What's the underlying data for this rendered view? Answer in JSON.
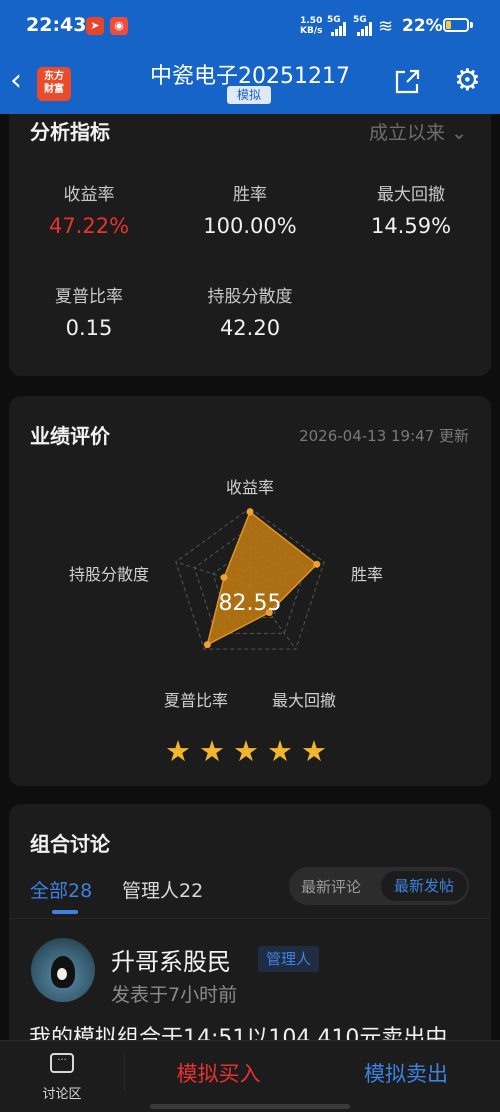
{
  "status_bar": {
    "time": "22:43",
    "net_speed_value": "1.50",
    "net_speed_unit": "KB/s",
    "sig1": "5G",
    "sig2": "5G",
    "battery": "22%"
  },
  "nav": {
    "logo_line1": "东方",
    "logo_line2": "财富",
    "title": "中瓷电子20251217",
    "badge": "模拟"
  },
  "analysis": {
    "title": "分析指标",
    "range": "成立以来",
    "metrics": [
      {
        "label": "收益率",
        "value": "47.22%"
      },
      {
        "label": "胜率",
        "value": "100.00%"
      },
      {
        "label": "最大回撤",
        "value": "14.59%"
      },
      {
        "label": "夏普比率",
        "value": "0.15"
      },
      {
        "label": "持股分散度",
        "value": "42.20"
      }
    ]
  },
  "performance": {
    "title": "业绩评价",
    "updated": "2026-04-13 19:47 更新",
    "score": "82.55",
    "radar_labels": [
      "收益率",
      "胜率",
      "最大回撤",
      "夏普比率",
      "持股分散度"
    ],
    "radar_values": [
      0.95,
      0.9,
      0.42,
      0.93,
      0.35
    ],
    "rating_stars": 5,
    "accent_color": "#c47d12",
    "star_color": "#f2b530"
  },
  "discussion": {
    "title": "组合讨论",
    "tab_all": "全部28",
    "tab_manager": "管理人22",
    "sort_latest_comment": "最新评论",
    "sort_latest_post": "最新发帖",
    "post": {
      "author": "升哥系股民",
      "role": "管理人",
      "posted": "发表于7小时前",
      "text": "我的模拟组合于14:51以104.410元卖出中"
    }
  },
  "bottom_bar": {
    "discuss_label": "讨论区",
    "buy_label": "模拟买入",
    "sell_label": "模拟卖出"
  },
  "colors": {
    "brand_blue": "#1664c8",
    "red": "#e8322e",
    "link_blue": "#3d82e0"
  }
}
